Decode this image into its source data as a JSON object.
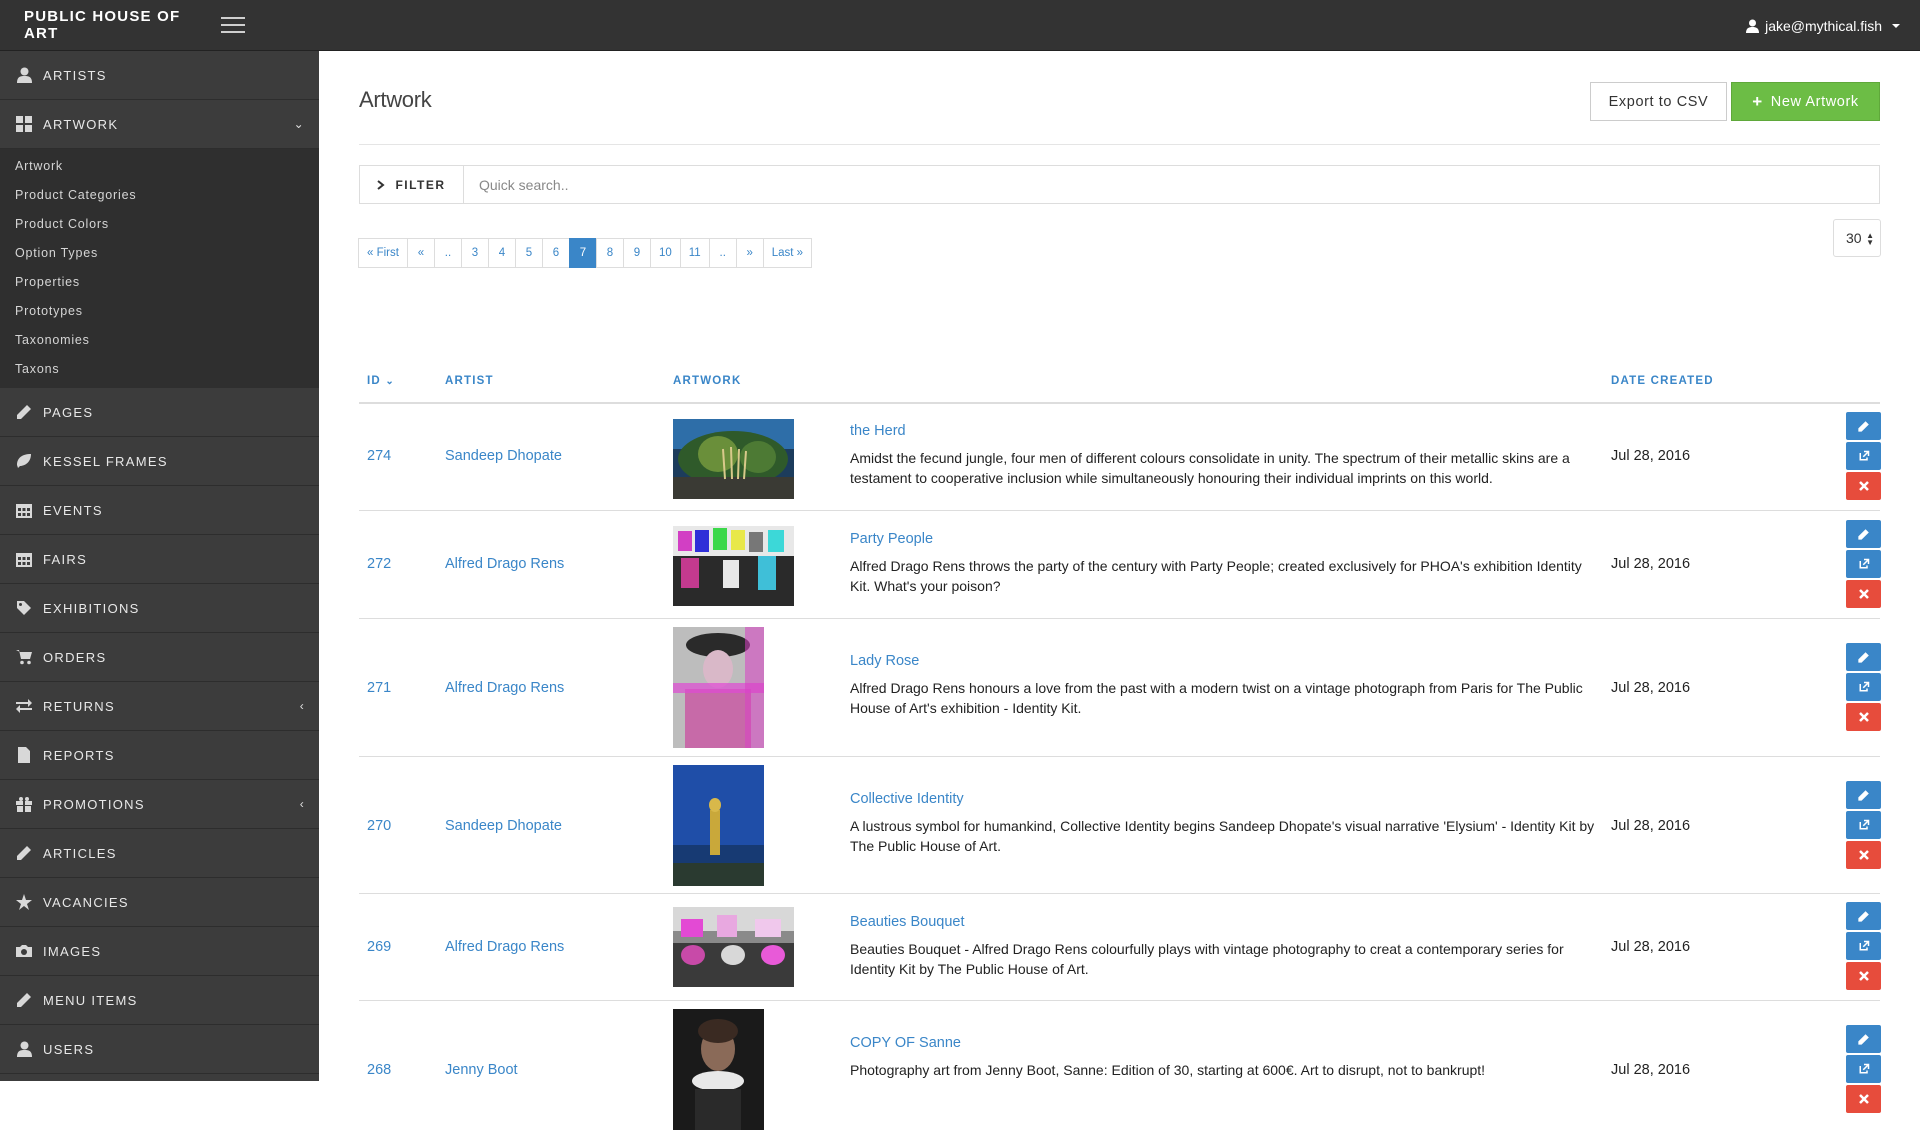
{
  "app": {
    "brand": "PUBLIC HOUSE OF ART",
    "user_email": "jake@mythical.fish"
  },
  "sidebar": {
    "items": [
      {
        "label": "ARTISTS",
        "icon": "user-icon"
      },
      {
        "label": "ARTWORK",
        "icon": "grid-icon",
        "expanded": true
      },
      {
        "label": "PAGES",
        "icon": "pencil-icon"
      },
      {
        "label": "KESSEL FRAMES",
        "icon": "leaf-icon"
      },
      {
        "label": "EVENTS",
        "icon": "calendar-icon"
      },
      {
        "label": "FAIRS",
        "icon": "calendar-icon"
      },
      {
        "label": "EXHIBITIONS",
        "icon": "tag-icon"
      },
      {
        "label": "ORDERS",
        "icon": "cart-icon"
      },
      {
        "label": "RETURNS",
        "icon": "transfer-icon",
        "has_submenu": true
      },
      {
        "label": "REPORTS",
        "icon": "file-icon"
      },
      {
        "label": "PROMOTIONS",
        "icon": "gift-icon",
        "has_submenu": true
      },
      {
        "label": "ARTICLES",
        "icon": "pencil-icon"
      },
      {
        "label": "VACANCIES",
        "icon": "star-icon"
      },
      {
        "label": "IMAGES",
        "icon": "camera-icon"
      },
      {
        "label": "MENU ITEMS",
        "icon": "pencil-icon"
      },
      {
        "label": "USERS",
        "icon": "user-icon"
      }
    ],
    "artwork_submenu": [
      "Artwork",
      "Product Categories",
      "Product Colors",
      "Option Types",
      "Properties",
      "Prototypes",
      "Taxonomies",
      "Taxons"
    ]
  },
  "main": {
    "title": "Artwork",
    "export_label": "Export to CSV",
    "new_label": "New Artwork",
    "filter_label": "FILTER",
    "search_placeholder": "Quick search..",
    "per_page": "30",
    "pagination": [
      "« First",
      "«",
      "..",
      "3",
      "4",
      "5",
      "6",
      "7",
      "8",
      "9",
      "10",
      "11",
      "..",
      "»",
      "Last »"
    ],
    "active_page": "7",
    "columns": {
      "id": "ID",
      "artist": "ARTIST",
      "artwork": "ARTWORK",
      "date": "DATE CREATED"
    },
    "rows": [
      {
        "id": "274",
        "artist": "Sandeep Dhopate",
        "title": "the Herd",
        "description": "Amidst the fecund jungle, four men of different colours consolidate in unity. The spectrum of their metallic skins are a testament to cooperative inclusion while simultaneously honouring their individual imprints on this world.",
        "date": "Jul 28, 2016"
      },
      {
        "id": "272",
        "artist": "Alfred Drago Rens",
        "title": "Party People",
        "description": "Alfred Drago Rens throws the party of the century with Party People; created exclusively for PHOA's exhibition Identity Kit. What's your poison?",
        "date": "Jul 28, 2016"
      },
      {
        "id": "271",
        "artist": "Alfred Drago Rens",
        "title": "Lady Rose",
        "description": "Alfred Drago Rens honours a love from the past with a modern twist on a vintage photograph from Paris for The Public House of Art's exhibition - Identity Kit.",
        "date": "Jul 28, 2016"
      },
      {
        "id": "270",
        "artist": "Sandeep Dhopate",
        "title": "Collective Identity",
        "description": "A lustrous symbol for humankind, Collective Identity begins Sandeep Dhopate's visual narrative 'Elysium' - Identity Kit by The Public House of Art.",
        "date": "Jul 28, 2016"
      },
      {
        "id": "269",
        "artist": "Alfred Drago Rens",
        "title": "Beauties Bouquet",
        "description": "Beauties Bouquet - Alfred Drago Rens colourfully plays with vintage photography to creat a contemporary series for Identity Kit by The Public House of Art.",
        "date": "Jul 28, 2016"
      },
      {
        "id": "268",
        "artist": "Jenny Boot",
        "title": "COPY OF Sanne",
        "description": "Photography art from Jenny Boot, Sanne: Edition of 30, starting at 600€. Art to disrupt, not to bankrupt!",
        "date": "Jul 28, 2016"
      }
    ]
  },
  "colors": {
    "topbar": "#333333",
    "sidebar": "#3c3c3c",
    "link": "#3a86c8",
    "success": "#6cbd45",
    "danger": "#e74c3c"
  }
}
